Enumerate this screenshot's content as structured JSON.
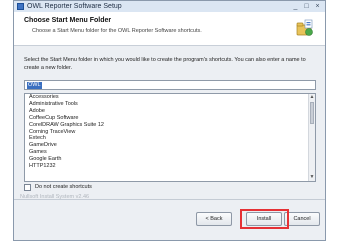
{
  "window": {
    "title": "OWL Reporter Software Setup",
    "minimize_label": "_",
    "maximize_label": "□",
    "close_label": "×"
  },
  "header": {
    "title": "Choose Start Menu Folder",
    "subtitle": "Choose a Start Menu folder for the OWL Reporter Software shortcuts."
  },
  "instructions": "Select the Start Menu folder in which you would like to create the program's shortcuts. You can also enter a name to create a new folder.",
  "folder_input": {
    "value": "OWL"
  },
  "folders": [
    "Accessories",
    "Administrative Tools",
    "Adobe",
    "CoffeeCup Software",
    "CorelDRAW Graphics Suite 12",
    "Corning TraceView",
    "Extech",
    "GameDrive",
    "Games",
    "Google Earth",
    "HTTP1232"
  ],
  "checkbox": {
    "label": "Do not create shortcuts",
    "checked": false
  },
  "branding": "Nullsoft Install System v2.46",
  "buttons": {
    "back": "< Back",
    "install": "Install",
    "cancel": "Cancel"
  },
  "colors": {
    "highlight": "#e53135",
    "selection": "#3a6fc0"
  }
}
